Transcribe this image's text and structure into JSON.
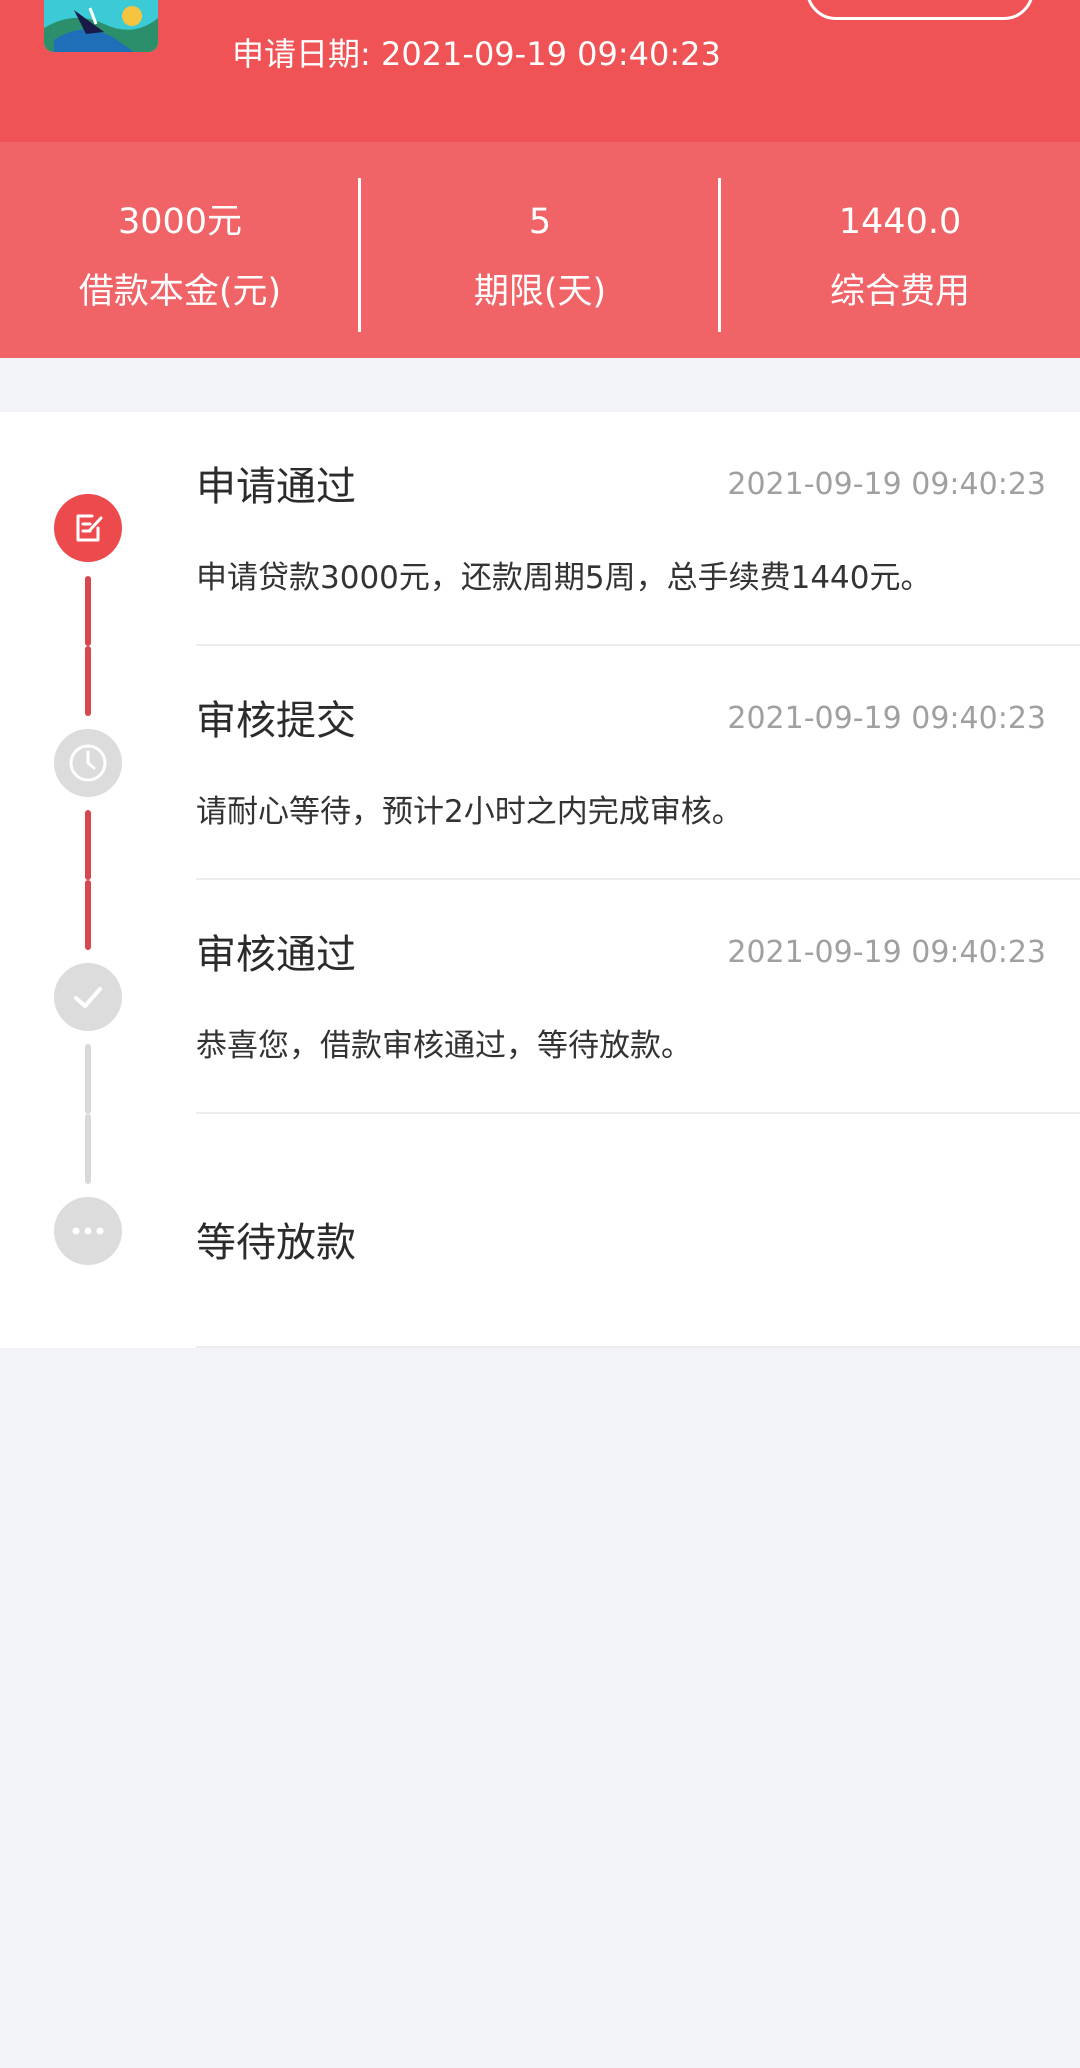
{
  "header": {
    "apply_date": "申请日期: 2021-09-19 09:40:23"
  },
  "stats": [
    {
      "value": "3000元",
      "label": "借款本金(元)"
    },
    {
      "value": "5",
      "label": "期限(天)"
    },
    {
      "value": "1440.0",
      "label": "综合费用"
    }
  ],
  "timeline": [
    {
      "title": "申请通过",
      "time": "2021-09-19 09:40:23",
      "desc": "申请贷款3000元，还款周期5周，总手续费1440元。",
      "icon": "edit-icon",
      "status": "active"
    },
    {
      "title": "审核提交",
      "time": "2021-09-19 09:40:23",
      "desc": "请耐心等待，预计2小时之内完成审核。",
      "icon": "clock-icon",
      "status": "inactive"
    },
    {
      "title": "审核通过",
      "time": "2021-09-19 09:40:23",
      "desc": "恭喜您，借款审核通过，等待放款。",
      "icon": "check-icon",
      "status": "inactive"
    },
    {
      "title": "等待放款",
      "icon": "more-icon",
      "status": "inactive"
    }
  ],
  "colors": {
    "brand_red": "#ef5356",
    "stats_red": "#f06366",
    "connector_done": "#d8474d",
    "connector_pending": "#d9d9d9",
    "page_bg": "#f3f4f8"
  }
}
